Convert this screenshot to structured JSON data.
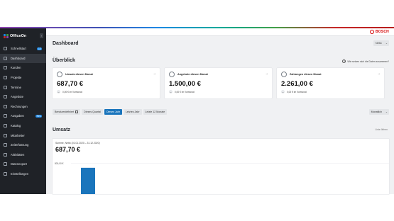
{
  "app": {
    "name": "OfficeOn",
    "collapse_glyph": "‹"
  },
  "sidebar": {
    "items": [
      {
        "label": "Schnellstart",
        "badge": "15",
        "icon": "rocket-icon"
      },
      {
        "label": "Dashboard",
        "icon": "dashboard-icon",
        "active": true
      },
      {
        "label": "Kunden",
        "icon": "customers-icon"
      },
      {
        "label": "Projekte",
        "icon": "projects-icon"
      },
      {
        "label": "Termine",
        "icon": "calendar-icon"
      },
      {
        "label": "Angebote",
        "icon": "offers-icon"
      },
      {
        "label": "Rechnungen",
        "icon": "invoices-icon"
      },
      {
        "label": "Ausgaben",
        "badge": "Neu",
        "icon": "expenses-icon"
      },
      {
        "label": "Katalog",
        "icon": "catalog-icon"
      },
      {
        "label": "Mitarbeiter",
        "icon": "employees-icon"
      },
      {
        "label": "Zeiterfassung",
        "icon": "timetracking-icon"
      },
      {
        "label": "Aktivitäten",
        "icon": "activities-icon"
      },
      {
        "label": "Datenexport",
        "icon": "export-icon"
      },
      {
        "label": "Einstellungen",
        "icon": "settings-icon"
      }
    ]
  },
  "header": {
    "brand": "BOSCH"
  },
  "page": {
    "title": "Dashboard",
    "netto_select": "Netto",
    "overview_title": "Überblick",
    "help_text": "Wie setzen sich die Daten zusammen?"
  },
  "cards": [
    {
      "title": "Umsatz diesen Monat",
      "value": "687,70 €",
      "sub": "0,00 € im Vormonat",
      "icon": "revenue-icon",
      "arrow": "→"
    },
    {
      "title": "Angebote diesen Monat",
      "value": "1.500,00 €",
      "sub": "0,00 € im Vormonat",
      "icon": "document-icon",
      "arrow": "→"
    },
    {
      "title": "Zahlungen diesen Monat",
      "value": "2.261,00 €",
      "sub": "0,00 € im Vormonat",
      "icon": "payment-icon",
      "arrow": "→"
    }
  ],
  "filters": {
    "custom": "Benutzerdefiniert",
    "options": [
      "Dieses Quartal",
      "Dieses Jahr",
      "Letztes Jahr",
      "Letzte 12 Monate"
    ],
    "selected": "Dieses Jahr",
    "granularity": "Monatlich"
  },
  "revenue": {
    "title": "Umsatz",
    "more_link": "Liste öffnen",
    "subtitle": "Summe, Netto (01.01.2020 – 31.12.2020)",
    "total": "687,70 €"
  },
  "chart_data": {
    "type": "bar",
    "tick_labels": [
      "800,00 €"
    ],
    "values": [
      687.7
    ],
    "ylim": [
      0,
      1000
    ],
    "color": "#1a75bc"
  },
  "colors": {
    "accent": "#1a75bc",
    "sidebar": "#1f2227",
    "brand_red": "#d50000"
  }
}
